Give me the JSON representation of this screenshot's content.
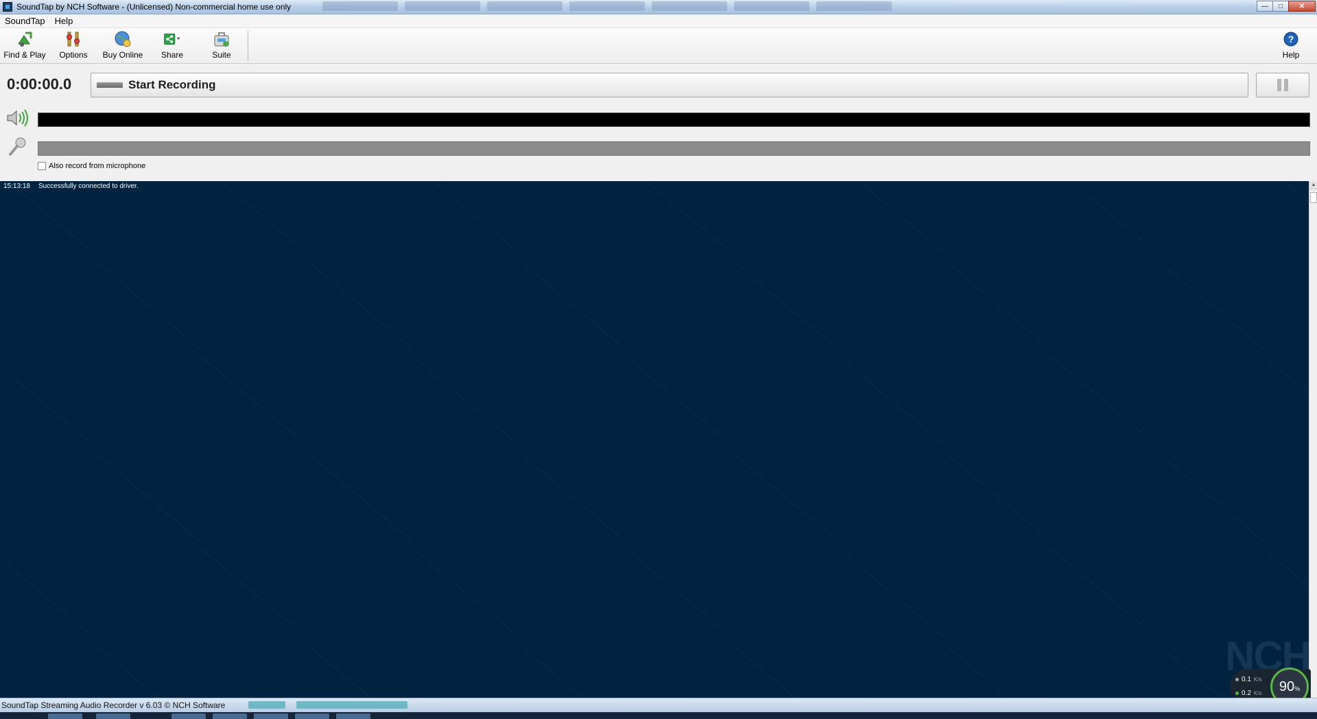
{
  "window": {
    "title": "SoundTap by NCH Software - (Unlicensed) Non-commercial home use only"
  },
  "menu": {
    "items": [
      "SoundTap",
      "Help"
    ]
  },
  "toolbar": {
    "find_play": "Find & Play",
    "options": "Options",
    "buy_online": "Buy Online",
    "share": "Share",
    "suite": "Suite",
    "help": "Help"
  },
  "recorder": {
    "timer": "0:00:00.0",
    "start_label": "Start Recording",
    "mic_checkbox_label": "Also record from microphone"
  },
  "log": {
    "entries": [
      {
        "time": "15:13:18",
        "message": "Successfully connected to driver."
      }
    ]
  },
  "network": {
    "upload": "0.1",
    "upload_unit": "K/s",
    "download": "0.2",
    "download_unit": "K/s",
    "gauge_value": "90",
    "gauge_unit": "%"
  },
  "status": {
    "text": "SoundTap Streaming Audio Recorder v 6.03 © NCH Software"
  },
  "colors": {
    "log_background": "#012340",
    "speaker_meter": "#000000",
    "mic_meter": "#8c8c8c"
  }
}
